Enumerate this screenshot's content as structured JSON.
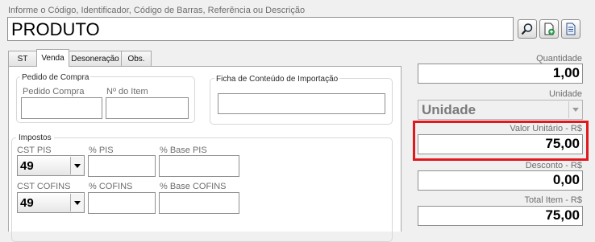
{
  "header": {
    "search_label": "Informe o Código, Identificador, Código de Barras, Referência ou Descrição",
    "search_value": "PRODUTO"
  },
  "toolbar": {
    "icons": [
      "search-icon",
      "add-document-icon",
      "document-icon"
    ]
  },
  "tabs": [
    {
      "label": "ST",
      "active": false
    },
    {
      "label": "Venda",
      "active": true
    },
    {
      "label": "Desoneração",
      "active": false
    },
    {
      "label": "Obs.",
      "active": false
    }
  ],
  "pedido": {
    "title": "Pedido de Compra",
    "pedido_label": "Pedido Compra",
    "item_label": "Nº do Item"
  },
  "ficha": {
    "title": "Ficha de Conteúdo de Importação"
  },
  "impostos": {
    "title": "Impostos",
    "cst_pis_label": "CST PIS",
    "cst_pis_value": "49",
    "pis_label": "% PIS",
    "base_pis_label": "% Base PIS",
    "cst_cofins_label": "CST COFINS",
    "cst_cofins_value": "49",
    "cofins_label": "% COFINS",
    "base_cofins_label": "% Base COFINS"
  },
  "summary": {
    "quantidade_label": "Quantidade",
    "quantidade_value": "1,00",
    "unidade_label": "Unidade",
    "unidade_value": "Unidade",
    "valor_label": "Valor Unitário - R$",
    "valor_value": "75,00",
    "desconto_label": "Desconto - R$",
    "desconto_value": "0,00",
    "total_label": "Total Item - R$",
    "total_value": "75,00"
  },
  "colors": {
    "highlight": "#e0191f"
  }
}
